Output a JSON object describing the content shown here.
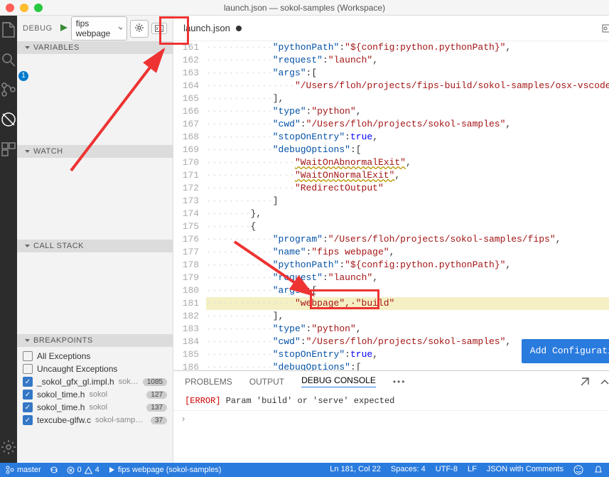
{
  "title": "launch.json — sokol-samples (Workspace)",
  "activity": {
    "badge": "1"
  },
  "debugHeader": {
    "label": "DEBUG",
    "config": "fips webpage"
  },
  "sections": {
    "variables": "VARIABLES",
    "watch": "WATCH",
    "callstack": "CALL STACK",
    "breakpoints": "BREAKPOINTS"
  },
  "breakpoints": [
    {
      "checked": false,
      "name": "All Exceptions",
      "sub": "",
      "count": ""
    },
    {
      "checked": false,
      "name": "Uncaught Exceptions",
      "sub": "",
      "count": ""
    },
    {
      "checked": true,
      "name": "_sokol_gfx_gl.impl.h",
      "sub": "sok…",
      "count": "1085"
    },
    {
      "checked": true,
      "name": "sokol_time.h",
      "sub": "sokol",
      "count": "127"
    },
    {
      "checked": true,
      "name": "sokol_time.h",
      "sub": "sokol",
      "count": "137"
    },
    {
      "checked": true,
      "name": "texcube-glfw.c",
      "sub": "sokol-samp…",
      "count": "37"
    }
  ],
  "tab": {
    "name": "launch.json"
  },
  "code": {
    "start": 161,
    "hlIndex": 20,
    "lines": [
      {
        "ws": "············",
        "key": "\"pythonPath\"",
        "sep": ":",
        "val": "\"${config:python.pythonPath}\"",
        "tail": ","
      },
      {
        "ws": "············",
        "key": "\"request\"",
        "sep": ":",
        "val": "\"launch\"",
        "tail": ","
      },
      {
        "ws": "············",
        "key": "\"args\"",
        "sep": ":[",
        "val": "",
        "tail": ""
      },
      {
        "ws": "················",
        "key": "",
        "sep": "",
        "val": "\"/Users/floh/projects/fips-build/sokol-samples/osx-vscode-debug/fi",
        "tail": ""
      },
      {
        "ws": "············",
        "key": "",
        "sep": "",
        "val": "",
        "tail": "],"
      },
      {
        "ws": "············",
        "key": "\"type\"",
        "sep": ":",
        "val": "\"python\"",
        "tail": ","
      },
      {
        "ws": "············",
        "key": "\"cwd\"",
        "sep": ":",
        "val": "\"/Users/floh/projects/sokol-samples\"",
        "tail": ","
      },
      {
        "ws": "············",
        "key": "\"stopOnEntry\"",
        "sep": ":",
        "bool": "true",
        "tail": ","
      },
      {
        "ws": "············",
        "key": "\"debugOptions\"",
        "sep": ":[",
        "val": "",
        "tail": ""
      },
      {
        "ws": "················",
        "key": "",
        "sep": "",
        "wavy": "\"WaitOnAbnormalExit\"",
        "tail": ","
      },
      {
        "ws": "················",
        "key": "",
        "sep": "",
        "wavy": "\"WaitOnNormalExit\"",
        "tail": ","
      },
      {
        "ws": "················",
        "key": "",
        "sep": "",
        "val": "\"RedirectOutput\"",
        "tail": ""
      },
      {
        "ws": "············",
        "key": "",
        "sep": "",
        "val": "",
        "tail": "]"
      },
      {
        "ws": "········",
        "key": "",
        "sep": "",
        "val": "",
        "tail": "},"
      },
      {
        "ws": "········",
        "key": "",
        "sep": "",
        "val": "",
        "tail": "{"
      },
      {
        "ws": "············",
        "key": "\"program\"",
        "sep": ":",
        "val": "\"/Users/floh/projects/sokol-samples/fips\"",
        "tail": ","
      },
      {
        "ws": "············",
        "key": "\"name\"",
        "sep": ":",
        "val": "\"fips webpage\"",
        "tail": ","
      },
      {
        "ws": "············",
        "key": "\"pythonPath\"",
        "sep": ":",
        "val": "\"${config:python.pythonPath}\"",
        "tail": ","
      },
      {
        "ws": "············",
        "key": "\"request\"",
        "sep": ":",
        "val": "\"launch\"",
        "tail": ","
      },
      {
        "ws": "············",
        "key": "\"args\"",
        "sep": ":[",
        "val": "",
        "tail": ""
      },
      {
        "ws": "················",
        "key": "",
        "sep": "",
        "val": "\"webpage\",·\"build\"",
        "tail": ""
      },
      {
        "ws": "············",
        "key": "",
        "sep": "",
        "val": "",
        "tail": "],"
      },
      {
        "ws": "············",
        "key": "\"type\"",
        "sep": ":",
        "val": "\"python\"",
        "tail": ","
      },
      {
        "ws": "············",
        "key": "\"cwd\"",
        "sep": ":",
        "val": "\"/Users/floh/projects/sokol-samples\"",
        "tail": ","
      },
      {
        "ws": "············",
        "key": "\"stopOnEntry\"",
        "sep": ":",
        "bool": "true",
        "tail": ","
      },
      {
        "ws": "············",
        "key": "\"debugOptions\"",
        "sep": ":[",
        "val": "",
        "tail": ""
      }
    ]
  },
  "addConfig": "Add Configuration...",
  "panel": {
    "tabs": {
      "problems": "PROBLEMS",
      "output": "OUTPUT",
      "debug": "DEBUG CONSOLE"
    },
    "errPrefix": "[ERROR]",
    "errMsg": " Param 'build' or 'serve' expected"
  },
  "breadcrumb": "›",
  "status": {
    "branch": "master",
    "errors": "0",
    "warnings": "4",
    "launch": "fips webpage (sokol-samples)",
    "pos": "Ln 181, Col 22",
    "spaces": "Spaces: 4",
    "enc": "UTF-8",
    "eol": "LF",
    "lang": "JSON with Comments"
  }
}
